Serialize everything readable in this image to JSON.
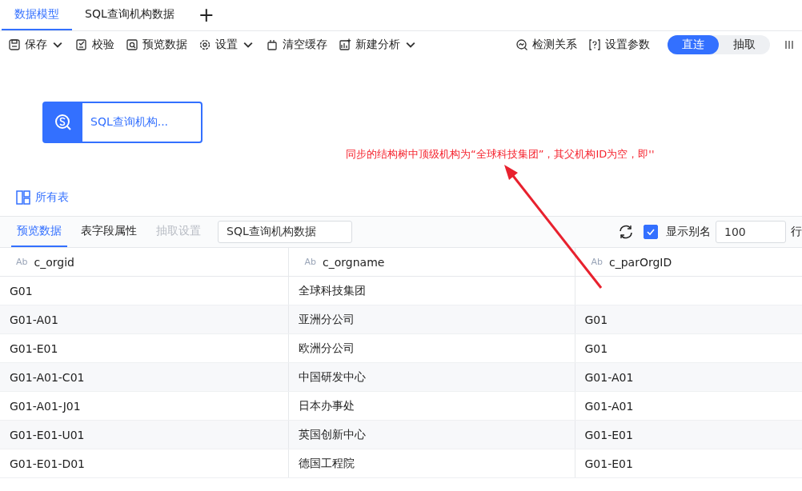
{
  "tabs": [
    {
      "label": "数据模型",
      "selected": true
    },
    {
      "label": "SQL查询机构数据",
      "selected": false
    }
  ],
  "add_tab": "+",
  "toolbar": {
    "left": [
      {
        "label": "保存",
        "dropdown": true
      },
      {
        "label": "校验",
        "dropdown": false
      },
      {
        "label": "预览数据",
        "dropdown": false
      },
      {
        "label": "设置",
        "dropdown": true
      },
      {
        "label": "清空缓存",
        "dropdown": false
      },
      {
        "label": "新建分析",
        "dropdown": true
      }
    ],
    "right": [
      {
        "label": "检测关系"
      },
      {
        "label": "设置参数"
      }
    ],
    "mode": [
      {
        "label": "直连",
        "selected": true
      },
      {
        "label": "抽取",
        "selected": false
      }
    ]
  },
  "canvas": {
    "node": {
      "label": "SQL查询机构..."
    },
    "all_tables": "所有表"
  },
  "annotation": "同步的结构树中顶级机构为“全球科技集团”，其父机构ID为空，即''",
  "preview": {
    "tabs": [
      {
        "label": "预览数据",
        "selected": true,
        "disabled": false
      },
      {
        "label": "表字段属性",
        "selected": false,
        "disabled": false
      },
      {
        "label": "抽取设置",
        "selected": false,
        "disabled": true
      }
    ],
    "table_name": "SQL查询机构数据",
    "show_alias": {
      "label": "显示别名",
      "checked": true
    },
    "row_count": "100",
    "row_unit": "行"
  },
  "table": {
    "columns": [
      {
        "type": "Ab",
        "name": "c_orgid"
      },
      {
        "type": "Ab",
        "name": "c_orgname"
      },
      {
        "type": "Ab",
        "name": "c_parOrgID"
      }
    ],
    "rows": [
      [
        "G01",
        "全球科技集团",
        ""
      ],
      [
        "G01-A01",
        "亚洲分公司",
        "G01"
      ],
      [
        "G01-E01",
        "欧洲分公司",
        "G01"
      ],
      [
        "G01-A01-C01",
        "中国研发中心",
        "G01-A01"
      ],
      [
        "G01-A01-J01",
        "日本办事处",
        "G01-A01"
      ],
      [
        "G01-E01-U01",
        "英国创新中心",
        "G01-E01"
      ],
      [
        "G01-E01-D01",
        "德国工程院",
        "G01-E01"
      ]
    ]
  }
}
